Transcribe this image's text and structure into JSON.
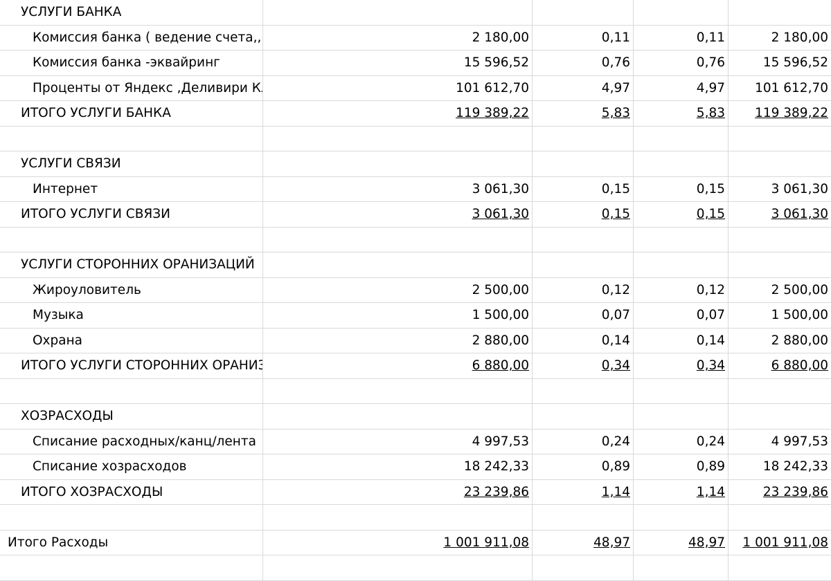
{
  "rows": [
    {
      "type": "header",
      "label": "УСЛУГИ БАНКА",
      "values": [
        "",
        "",
        "",
        ""
      ]
    },
    {
      "type": "item",
      "label": "Комиссия банка ( ведение счета,,)",
      "values": [
        "2 180,00",
        "0,11",
        "0,11",
        "2 180,00"
      ]
    },
    {
      "type": "item",
      "label": "Комиссия банка -эквайринг",
      "values": [
        "15 596,52",
        "0,76",
        "0,76",
        "15 596,52"
      ]
    },
    {
      "type": "item",
      "label": "Проценты от Яндекс ,Деливири Клаб",
      "values": [
        "101 612,70",
        "4,97",
        "4,97",
        "101 612,70"
      ]
    },
    {
      "type": "total",
      "label": "ИТОГО УСЛУГИ БАНКА",
      "values": [
        "119 389,22",
        "5,83",
        "5,83",
        "119 389,22"
      ]
    },
    {
      "type": "blank",
      "label": "",
      "values": [
        "",
        "",
        "",
        ""
      ]
    },
    {
      "type": "header",
      "label": "УСЛУГИ СВЯЗИ",
      "values": [
        "",
        "",
        "",
        ""
      ]
    },
    {
      "type": "item",
      "label": "Интернет",
      "values": [
        "3 061,30",
        "0,15",
        "0,15",
        "3 061,30"
      ]
    },
    {
      "type": "total",
      "label": "ИТОГО УСЛУГИ СВЯЗИ",
      "values": [
        "3 061,30",
        "0,15",
        "0,15",
        "3 061,30"
      ]
    },
    {
      "type": "blank",
      "label": "",
      "values": [
        "",
        "",
        "",
        ""
      ]
    },
    {
      "type": "header",
      "label": "УСЛУГИ СТОРОННИХ ОРАНИЗАЦИЙ",
      "values": [
        "",
        "",
        "",
        ""
      ]
    },
    {
      "type": "item",
      "label": "Жироуловитель",
      "values": [
        "2 500,00",
        "0,12",
        "0,12",
        "2 500,00"
      ]
    },
    {
      "type": "item",
      "label": "Музыка",
      "values": [
        "1 500,00",
        "0,07",
        "0,07",
        "1 500,00"
      ]
    },
    {
      "type": "item",
      "label": "Охрана",
      "values": [
        "2 880,00",
        "0,14",
        "0,14",
        "2 880,00"
      ]
    },
    {
      "type": "total",
      "label": "ИТОГО УСЛУГИ СТОРОННИХ ОРАНИЗАЦИЙ",
      "values": [
        "6 880,00",
        "0,34",
        "0,34",
        "6 880,00"
      ]
    },
    {
      "type": "blank",
      "label": "",
      "values": [
        "",
        "",
        "",
        ""
      ]
    },
    {
      "type": "header",
      "label": "ХОЗРАСХОДЫ",
      "values": [
        "",
        "",
        "",
        ""
      ]
    },
    {
      "type": "item",
      "label": "Списание расходных/канц/лента",
      "values": [
        "4 997,53",
        "0,24",
        "0,24",
        "4 997,53"
      ]
    },
    {
      "type": "item",
      "label": "Списание хозрасходов",
      "values": [
        "18 242,33",
        "0,89",
        "0,89",
        "18 242,33"
      ]
    },
    {
      "type": "total",
      "label": "ИТОГО ХОЗРАСХОДЫ",
      "values": [
        "23 239,86",
        "1,14",
        "1,14",
        "23 239,86"
      ]
    },
    {
      "type": "blank",
      "label": "",
      "values": [
        "",
        "",
        "",
        ""
      ]
    },
    {
      "type": "grand",
      "label": "Итого Расходы",
      "values": [
        "1 001 911,08",
        "48,97",
        "48,97",
        "1 001 911,08"
      ]
    },
    {
      "type": "blank",
      "label": "",
      "values": [
        "",
        "",
        "",
        ""
      ]
    }
  ]
}
